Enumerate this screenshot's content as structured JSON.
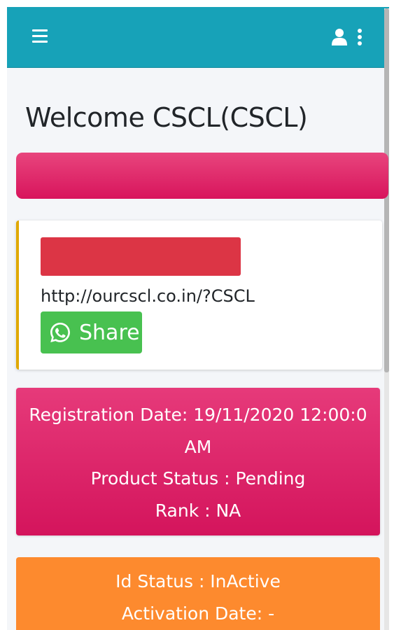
{
  "header": {
    "menu_icon": "hamburger-menu-icon",
    "user_icon": "user-icon",
    "more_icon": "kebab-more-icon",
    "bar_color": "#17a2b8"
  },
  "welcome": {
    "title": "Welcome CSCL(CSCL)"
  },
  "referral": {
    "link": "http://ourcscl.co.in/?CSCL",
    "share_label": "Share",
    "share_icon": "whatsapp-icon",
    "accent_color": "#e0a800",
    "redacted_color": "#dc3545"
  },
  "account": {
    "registration_line_1": "Registration Date: 19/11/2020 12:00:0",
    "registration_line_2": "AM",
    "product_status": "Product Status : Pending",
    "rank": "Rank : NA",
    "card_color": "#d81b60"
  },
  "status": {
    "id_status": "Id Status : InActive",
    "activation_date": "Activation Date: -",
    "card_color": "#fd8a2e"
  }
}
